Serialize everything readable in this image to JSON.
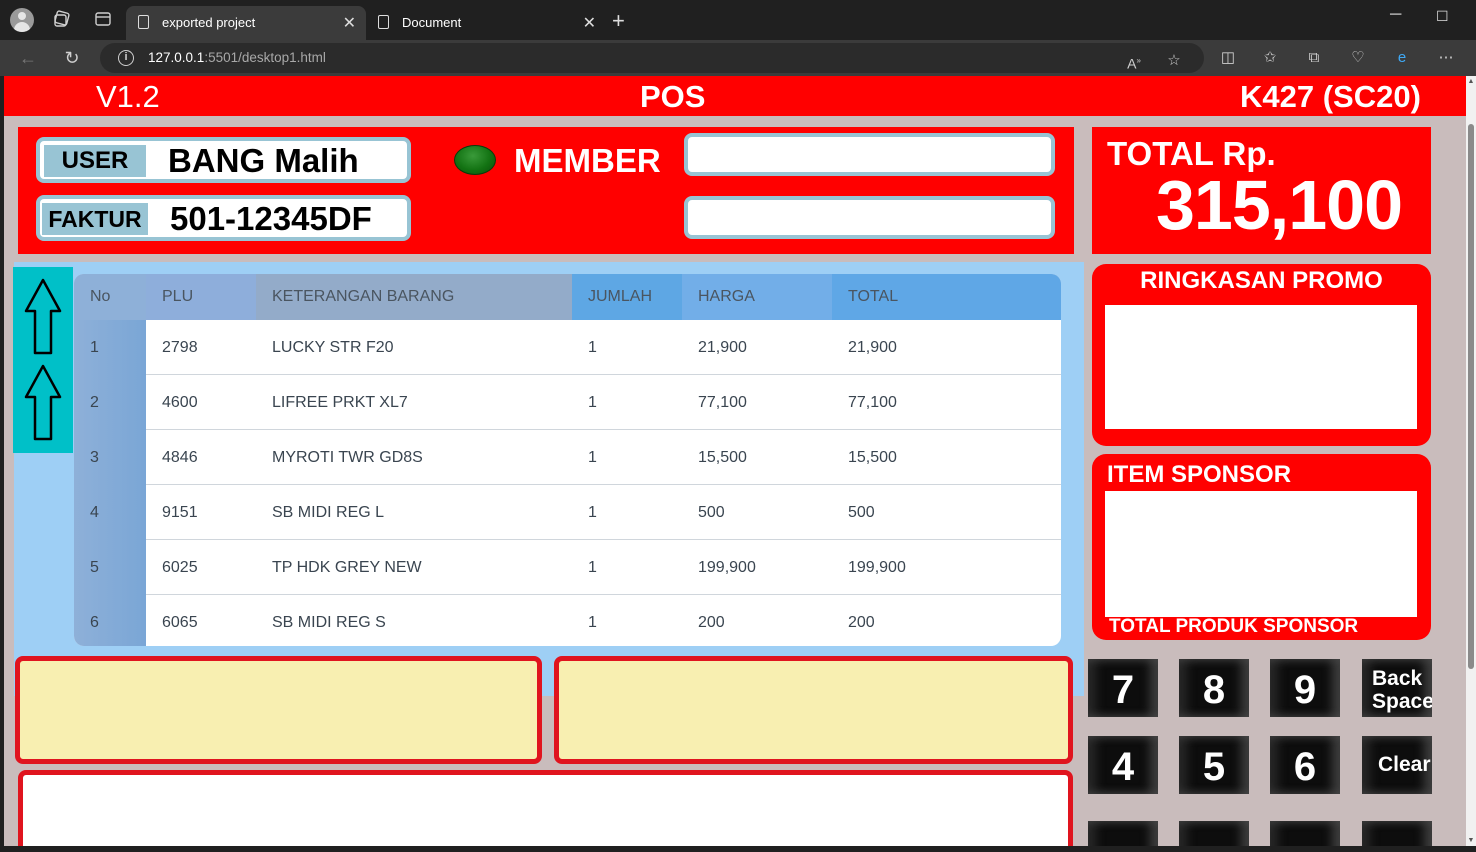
{
  "browser": {
    "tabs": [
      {
        "label": "exported project",
        "active": true
      },
      {
        "label": "Document",
        "active": false
      }
    ],
    "url_host": "127.0.0.1",
    "url_rest": ":5501/desktop1.html"
  },
  "header": {
    "version": "V1.2",
    "title": "POS",
    "store": "K427 (SC20)"
  },
  "info": {
    "user_label": "USER",
    "user_value": "BANG Malih",
    "faktur_label": "FAKTUR",
    "faktur_value": "501-12345DF",
    "member_label": "MEMBER",
    "member_status_color": "#137313"
  },
  "total": {
    "label": "TOTAL Rp.",
    "value": "315,100"
  },
  "table": {
    "columns": [
      "No",
      "PLU",
      "KETERANGAN BARANG",
      "JUMLAH",
      "HARGA",
      "TOTAL"
    ],
    "rows": [
      {
        "no": "1",
        "plu": "2798",
        "ket": "LUCKY STR F20",
        "jumlah": "1",
        "harga": "21,900",
        "total": "21,900"
      },
      {
        "no": "2",
        "plu": "4600",
        "ket": "LIFREE PRKT XL7",
        "jumlah": "1",
        "harga": "77,100",
        "total": "77,100"
      },
      {
        "no": "3",
        "plu": "4846",
        "ket": "MYROTI TWR GD8S",
        "jumlah": "1",
        "harga": "15,500",
        "total": "15,500"
      },
      {
        "no": "4",
        "plu": "9151",
        "ket": "SB MIDI REG L",
        "jumlah": "1",
        "harga": "500",
        "total": "500"
      },
      {
        "no": "5",
        "plu": "6025",
        "ket": "TP HDK GREY NEW",
        "jumlah": "1",
        "harga": "199,900",
        "total": "199,900"
      },
      {
        "no": "6",
        "plu": "6065",
        "ket": "SB MIDI REG S",
        "jumlah": "1",
        "harga": "200",
        "total": "200"
      }
    ]
  },
  "promo": {
    "title": "RINGKASAN PROMO"
  },
  "sponsor": {
    "title": "ITEM SPONSOR",
    "total_label": "TOTAL PRODUK SPONSOR"
  },
  "keypad": {
    "k7": "7",
    "k8": "8",
    "k9": "9",
    "back_line1": "Back",
    "back_line2": "Space",
    "k4": "4",
    "k5": "5",
    "k6": "6",
    "clear": "Clear"
  },
  "colors": {
    "header_red": "#ff0000",
    "accent_blue": "#98c4d4",
    "table_bg": "#9ecff5",
    "arrow_panel": "#00c0c8",
    "yellow_box": "#f8efb1"
  }
}
